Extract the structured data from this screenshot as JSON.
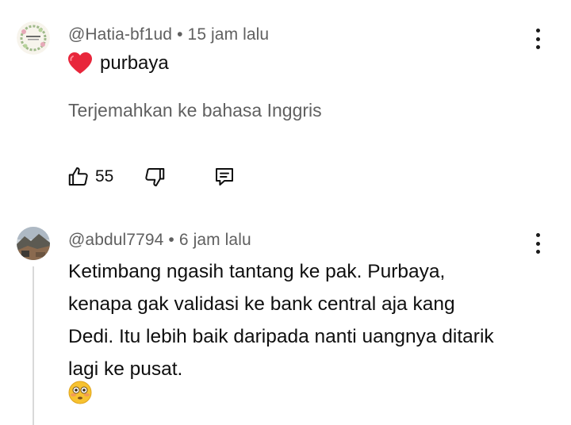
{
  "comments": [
    {
      "author": "@Hatia-bf1ud",
      "separator": "•",
      "time": "15 jam lalu",
      "text": "purbaya",
      "text_prefix_icon": "red-heart-emoji",
      "translate_label": "Terjemahkan ke bahasa Inggris",
      "like_count": "55",
      "avatar_icon": "floral-wreath-avatar"
    },
    {
      "author": "@abdul7794",
      "separator": "•",
      "time": "6 jam lalu",
      "text_lines": [
        "Ketimbang ngasih tantang ke pak. Purbaya,",
        "kenapa gak validasi ke bank central aja kang",
        "Dedi. Itu lebih baik daripada nanti uangnya ditarik",
        "lagi ke pusat."
      ],
      "trailing_emoji": "flushed-face-emoji",
      "avatar_icon": "landscape-photo-avatar"
    }
  ],
  "colors": {
    "text_primary": "#0f0f0f",
    "text_secondary": "#606060",
    "heart_red": "#e8263b",
    "thread_line": "#d9d9d9"
  },
  "icons": {
    "like": "thumb-up-outline-icon",
    "dislike": "thumb-down-outline-icon",
    "reply": "reply-comment-icon",
    "menu": "vertical-dots-icon"
  }
}
